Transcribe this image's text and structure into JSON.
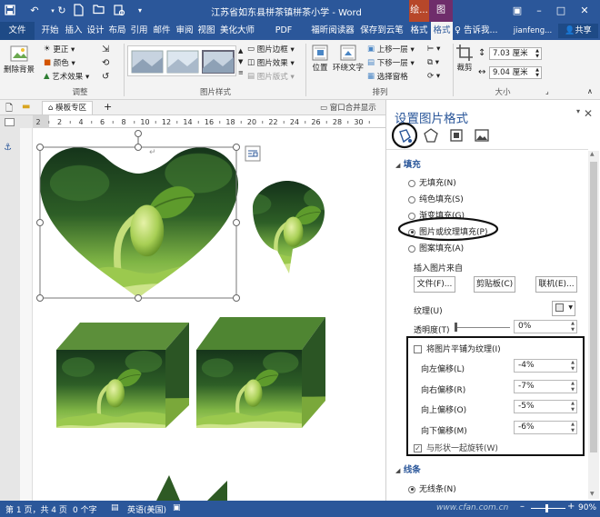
{
  "titlebar": {
    "doc_title": "江苏省如东县栟茶镇栟茶小学 - Word",
    "ctx_tab_drawing": "绘...",
    "ctx_tab_picture": "图片..."
  },
  "tabs": [
    "文件",
    "开始",
    "插入",
    "设计",
    "布局",
    "引用",
    "邮件",
    "审阅",
    "视图",
    "美化大师",
    "PDF Architect",
    "福昕阅读器",
    "保存到云笔记",
    "格式",
    "格式"
  ],
  "search_placeholder": "告诉我...",
  "user": "jianfeng...",
  "share_label": "共享",
  "ribbon": {
    "remove_bg": "删除背景",
    "adjust": {
      "corrections": "更正",
      "color": "颜色",
      "artistic": "艺术效果",
      "label": "调整"
    },
    "picture_styles": {
      "border": "图片边框",
      "effects": "图片效果",
      "layout": "图片版式",
      "label": "图片样式"
    },
    "arrange": {
      "position": "位置",
      "wrap": "环绕文字",
      "forward": "上移一层",
      "backward": "下移一层",
      "selection": "选择窗格",
      "label": "排列"
    },
    "size": {
      "crop": "裁剪",
      "height": "7.03 厘米",
      "width": "9.04 厘米",
      "label": "大小"
    }
  },
  "docbar": {
    "tab_label": "模板专区",
    "window_merge": "窗口合并显示"
  },
  "ruler_numbers": [
    "2",
    "2",
    "4",
    "6",
    "8",
    "10",
    "12",
    "14",
    "16",
    "18",
    "20",
    "22",
    "24",
    "26",
    "28",
    "30"
  ],
  "pane": {
    "title": "设置图片格式",
    "fill_header": "填充",
    "fill_options": [
      "无填充(N)",
      "纯色填充(S)",
      "渐变填充(G)",
      "图片或纹理填充(P)",
      "图案填充(A)"
    ],
    "insert_from": "插入图片来自",
    "btn_file": "文件(F)...",
    "btn_clipboard": "剪贴板(C)",
    "btn_online": "联机(E)...",
    "texture_label": "纹理(U)",
    "transparency_label": "透明度(T)",
    "transparency_value": "0%",
    "tile_checkbox": "将图片平铺为纹理(I)",
    "offsets": [
      {
        "label": "向左偏移(L)",
        "value": "-4%"
      },
      {
        "label": "向右偏移(R)",
        "value": "-7%"
      },
      {
        "label": "向上偏移(O)",
        "value": "-5%"
      },
      {
        "label": "向下偏移(M)",
        "value": "-6%"
      }
    ],
    "rotate_checkbox": "与形状一起旋转(W)",
    "line_header": "线条",
    "line_option": "无线条(N)"
  },
  "status": {
    "page": "第 1 页，共 4 页",
    "words": "0 个字",
    "language": "英语(美国)",
    "zoom": "90%",
    "watermark": "www.cfan.com.cn"
  },
  "colors": {
    "word_blue": "#2b579a",
    "context_red": "#b7472a",
    "accent_blue": "#2b579a"
  }
}
